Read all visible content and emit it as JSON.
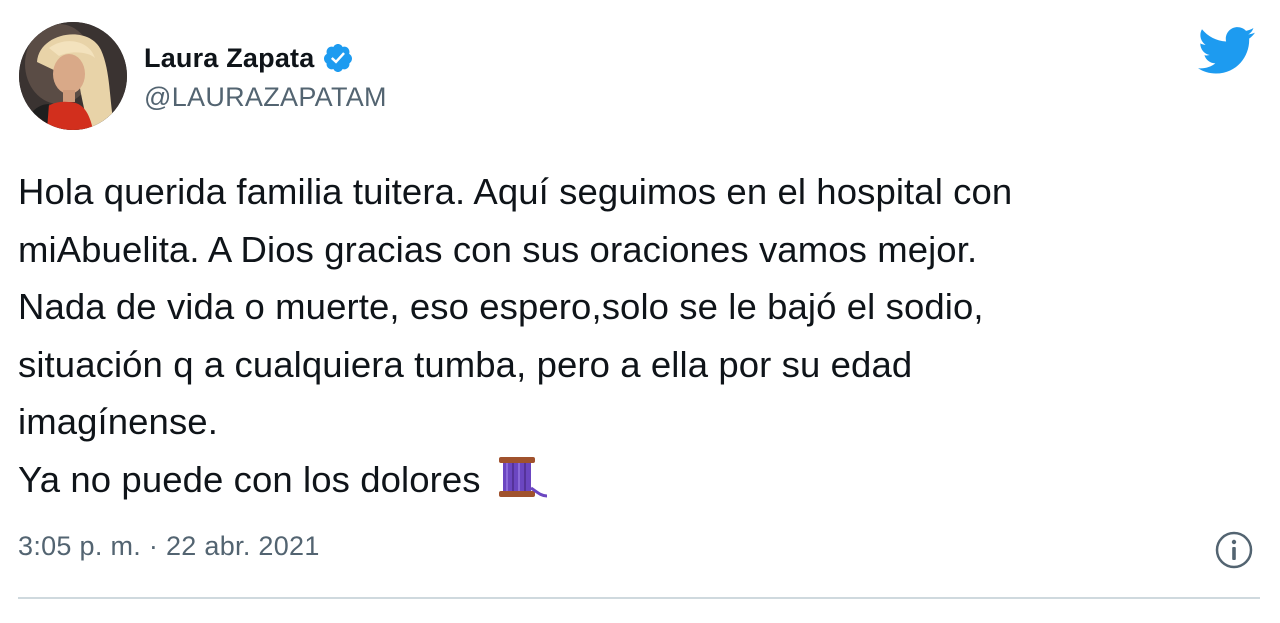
{
  "author": {
    "display_name": "Laura Zapata",
    "handle": "@LAURAZAPATAM",
    "verified": true,
    "avatar_icon": "profile-photo"
  },
  "tweet": {
    "lines": [
      "Hola querida familia tuitera. Aquí seguimos en el hospital con",
      "miAbuelita. A Dios gracias con sus oraciones vamos mejor.",
      "Nada de vida o muerte, eso espero,solo se le bajó el sodio,",
      "situación q a cualquiera tumba, pero a ella por su edad",
      "imagínense.",
      "Ya no puede con los dolores"
    ],
    "emoji": "thread-spool-emoji",
    "timestamp": "3:05 p. m. · 22 abr. 2021"
  },
  "icons": {
    "brand": "twitter-bird-icon",
    "info": "info-icon",
    "verified": "verified-badge-icon"
  },
  "colors": {
    "brand_blue": "#1d9bf0",
    "text_primary": "#0f1419",
    "text_secondary": "#536471",
    "divider": "#cfd9de",
    "thread_purple": "#6b46c1"
  }
}
